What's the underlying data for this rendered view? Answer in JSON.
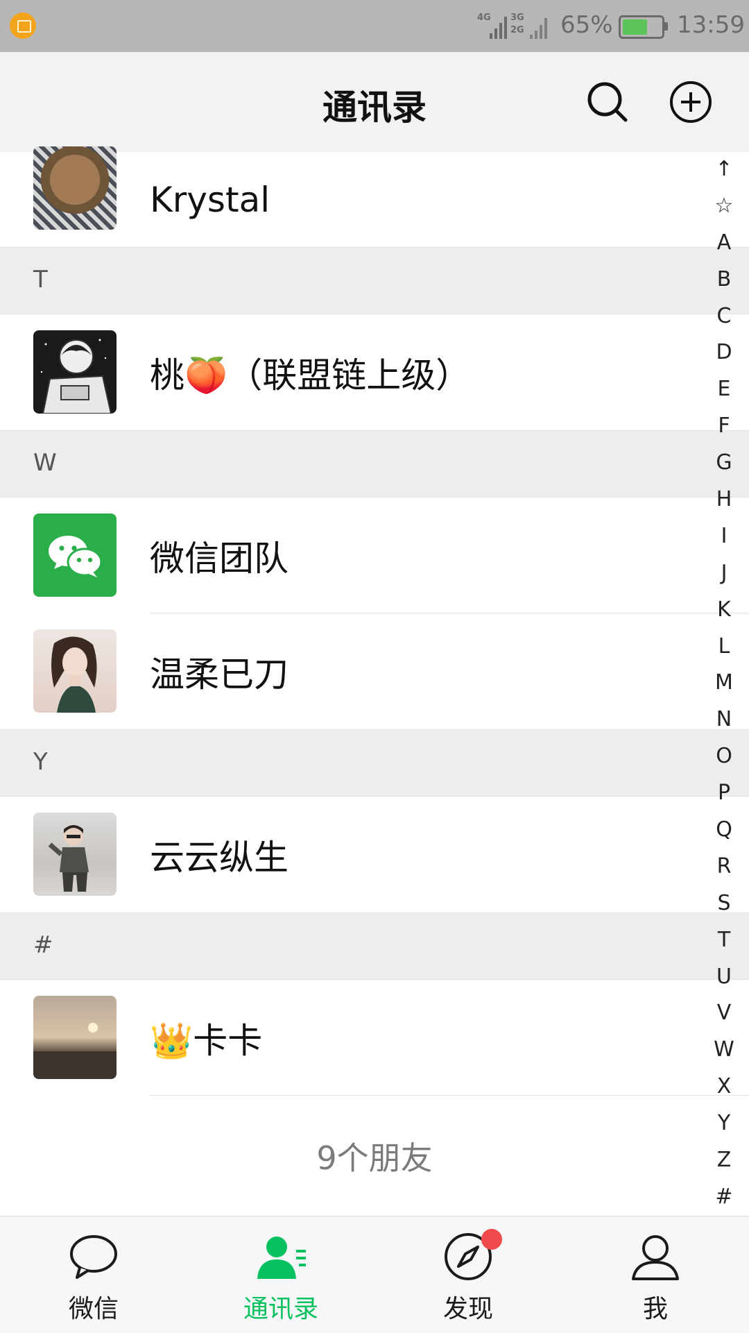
{
  "status_bar": {
    "signal_1": "4G",
    "signal_2_top": "3G",
    "signal_2_bottom": "2G",
    "battery_percent": "65%",
    "battery_level": 0.65,
    "time": "13:59"
  },
  "header": {
    "title": "通讯录",
    "search_icon": "search-icon",
    "add_icon": "plus-circle-icon"
  },
  "contacts": {
    "krystal": {
      "name": "Krystal"
    },
    "section_t": "T",
    "tao": {
      "name": "桃🍑（联盟链上级）"
    },
    "section_w": "W",
    "wechat_team": {
      "name": "微信团队"
    },
    "wenrou": {
      "name": "温柔已刀"
    },
    "section_y": "Y",
    "yunyun": {
      "name": "云云纵生"
    },
    "section_hash": "#",
    "kaka": {
      "name": "👑卡卡"
    },
    "friend_count": "9个朋友"
  },
  "alpha_index": [
    "↑",
    "☆",
    "A",
    "B",
    "C",
    "D",
    "E",
    "F",
    "G",
    "H",
    "I",
    "J",
    "K",
    "L",
    "M",
    "N",
    "O",
    "P",
    "Q",
    "R",
    "S",
    "T",
    "U",
    "V",
    "W",
    "X",
    "Y",
    "Z",
    "#"
  ],
  "bottom_nav": {
    "chats": "微信",
    "contacts": "通讯录",
    "discover": "发现",
    "me": "我"
  },
  "colors": {
    "accent": "#07c160",
    "badge": "#f0494b"
  }
}
